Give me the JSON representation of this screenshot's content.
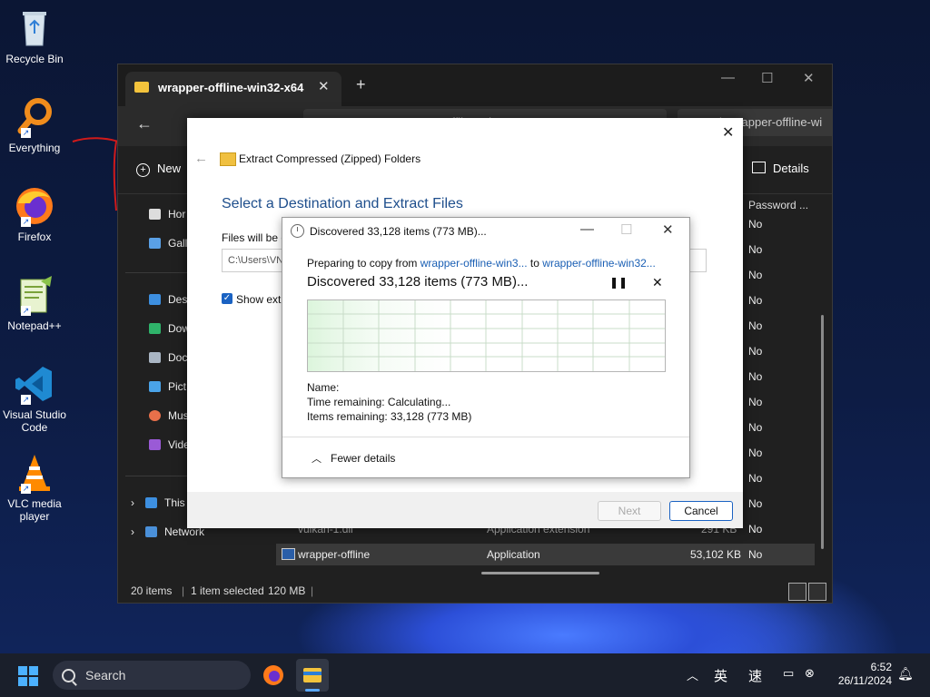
{
  "desktop": {
    "icons": [
      {
        "label": "Recycle Bin"
      },
      {
        "label": "Everything"
      },
      {
        "label": "Firefox"
      },
      {
        "label": "Notepad++"
      },
      {
        "label_line1": "Visual Studio",
        "label_line2": "Code"
      },
      {
        "label_line1": "VLC media",
        "label_line2": "player"
      }
    ]
  },
  "explorer": {
    "tab_title": "wrapper-offline-win32-x64",
    "address_text": "offline-win32-x64",
    "search_placeholder": "Search wrapper-offline-wi",
    "new_label": "New",
    "details_label": "Details",
    "sidebar": [
      "Hor",
      "Gall",
      "Desi",
      "Dow",
      "Doc",
      "Pict",
      "Mus",
      "Vide",
      "This",
      "Network"
    ],
    "column_header": "Password ...",
    "password_values": [
      "No",
      "No",
      "No",
      "No",
      "No",
      "No",
      "No",
      "No",
      "No",
      "No",
      "No",
      "No",
      "No",
      "No"
    ],
    "rows": [
      {
        "name": "vulkan-1.dll",
        "type": "Application extension",
        "size": "291 KB",
        "password": "No"
      },
      {
        "name": "wrapper-offline",
        "type": "Application",
        "size": "53,102 KB",
        "password": "No"
      }
    ],
    "status": {
      "items": "20 items",
      "selected": "1 item selected",
      "size": "120 MB"
    }
  },
  "wizard": {
    "title": "Extract Compressed (Zipped) Folders",
    "heading": "Select a Destination and Extract Files",
    "files_label": "Files will be e",
    "path_value": "C:\\Users\\VN",
    "show_label": "Show extr",
    "next_label": "Next",
    "cancel_label": "Cancel"
  },
  "progress_dialog": {
    "title": "Discovered 33,128 items (773 MB)...",
    "preparing_prefix": "Preparing to copy from",
    "source": "wrapper-offline-win3...",
    "to_word": "to",
    "destination": "wrapper-offline-win32...",
    "big_status": "Discovered 33,128 items (773 MB)...",
    "name_label": "Name:",
    "time_remaining": "Time remaining:  Calculating...",
    "items_remaining": "Items remaining:  33,128 (773 MB)",
    "fewer_details": "Fewer details"
  },
  "taskbar": {
    "search_label": "Search",
    "ime_lang": "英",
    "ime_mode": "速",
    "time": "6:52",
    "date": "26/11/2024"
  }
}
